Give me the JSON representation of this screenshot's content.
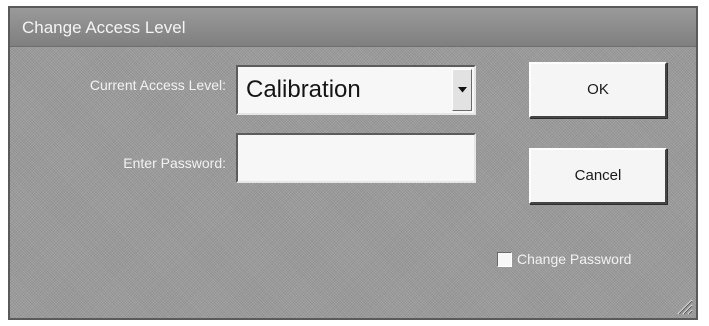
{
  "window": {
    "title": "Change Access Level"
  },
  "form": {
    "access_level_label": "Current Access Level:",
    "access_level_value": "Calibration",
    "password_label": "Enter Password:",
    "password_value": "",
    "password_placeholder": ""
  },
  "buttons": {
    "ok_label": "OK",
    "cancel_label": "Cancel"
  },
  "options": {
    "change_password_label": "Change Password",
    "change_password_checked": false
  },
  "icons": {
    "dropdown": "chevron-down-icon",
    "resize": "resize-grip-icon"
  },
  "colors": {
    "dialog_background": "#9b9b9b",
    "title_bar": "#8a8a8a",
    "label_text": "#f2f2f2",
    "field_background": "#f7f7f7"
  }
}
